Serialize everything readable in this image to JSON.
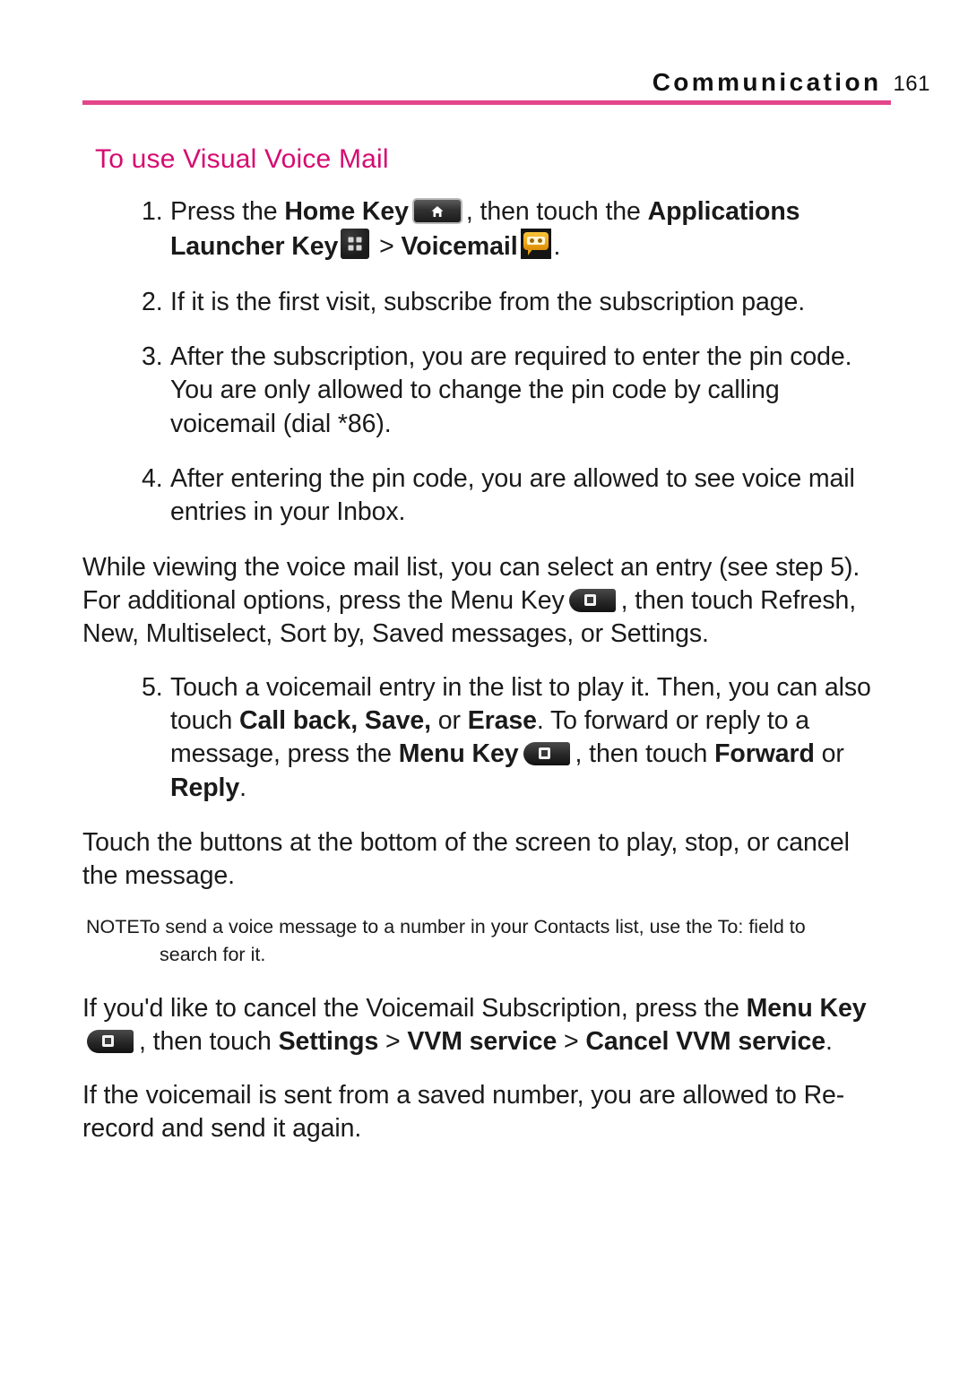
{
  "header": {
    "chapter": "Communication",
    "page_number": "161",
    "rule_color": "#e2458a"
  },
  "section": {
    "title": "To use Visual Voice Mail",
    "title_color": "#d60b70"
  },
  "steps": [
    {
      "number": "1.",
      "segments": [
        {
          "text": "Press the ",
          "bold": false
        },
        {
          "text": "Home Key",
          "bold": true
        },
        {
          "icon": "home-key-icon"
        },
        {
          "text": ", then touch the ",
          "bold": false
        },
        {
          "text": "Applications Launcher Key",
          "bold": true
        },
        {
          "icon": "applications-launcher-key-icon"
        },
        {
          "text": " > ",
          "bold": false
        },
        {
          "text": "Voicemail",
          "bold": true
        },
        {
          "icon": "voicemail-app-icon"
        },
        {
          "text": ".",
          "bold": false
        }
      ]
    },
    {
      "number": "2.",
      "segments": [
        {
          "text": "If it is the first visit, subscribe from the subscription page.",
          "bold": false
        }
      ]
    },
    {
      "number": "3.",
      "segments": [
        {
          "text": "After the subscription, you are required to enter the pin code. You are only allowed to change the pin code by calling voicemail (dial *86).",
          "bold": false
        }
      ]
    },
    {
      "number": "4.",
      "segments": [
        {
          "text": "After entering the pin code, you are allowed to see voice mail entries in your Inbox.",
          "bold": false
        }
      ]
    }
  ],
  "paragraph_menu": {
    "part1": "While viewing the voice mail list, you can select an entry (see step 5). For additional options, press the Menu Key",
    "part2": ", then touch Refresh, New, Multiselect, Sort by, Saved messages, or Settings.",
    "icon": "menu-key-icon"
  },
  "step5": {
    "number": "5.",
    "part1": "Touch a voicemail entry in the list to play it. Then, you can also touch ",
    "bold1": "Call back, Save,",
    "mid1": " or ",
    "bold2": "Erase",
    "mid2": ". To forward or reply to a message, press the ",
    "bold3": "Menu Key",
    "icon": "menu-key-icon",
    "mid3": ", then touch ",
    "bold4": "Forward",
    "mid4": " or ",
    "bold5": "Reply",
    "end": "."
  },
  "paragraph_buttons": {
    "text": "Touch the buttons at the bottom of the screen to play, stop, or cancel the message."
  },
  "note": {
    "label": "NOTE",
    "label_color": "#e2006c",
    "line1": "To send a voice message to a number in your Contacts list, use the To: field to",
    "line2": "search for it."
  },
  "paragraph_cancel": {
    "part1": "If you'd like to cancel the Voicemail Subscription, press the ",
    "bold1": "Menu Key",
    "icon": "menu-key-icon",
    "mid1": ", then touch ",
    "bold2": "Settings",
    "mid2": " > ",
    "bold3": "VVM service",
    "mid3": " > ",
    "bold4": "Cancel VVM service",
    "end": "."
  },
  "paragraph_rerecord": {
    "text": "If the voicemail is sent from a saved number, you are allowed to Re-record and send it again."
  }
}
